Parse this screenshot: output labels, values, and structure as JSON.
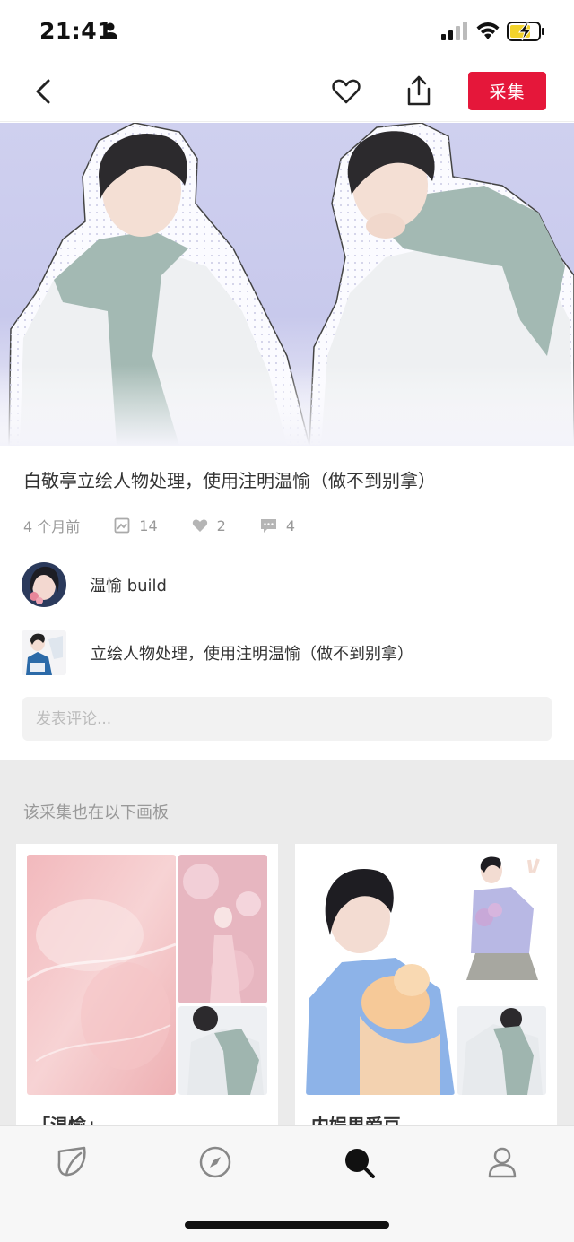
{
  "status_bar": {
    "time": "21:41",
    "icons": [
      "person-icon",
      "signal-icon",
      "wifi-icon",
      "battery-charging-icon"
    ]
  },
  "nav": {
    "back_icon": "chevron-left-icon",
    "like_icon": "heart-icon",
    "share_icon": "share-icon",
    "collect_label": "采集",
    "accent_color": "#e5173a"
  },
  "pin": {
    "title": "白敬亭立绘人物处理，使用注明温愉（做不到别拿）",
    "time_ago": "4 个月前",
    "repins": "14",
    "likes": "2",
    "comments": "4"
  },
  "author": {
    "name": "温愉 build"
  },
  "board": {
    "name": "立绘人物处理，使用注明温愉（做不到别拿）"
  },
  "comment": {
    "placeholder": "发表评论..."
  },
  "related": {
    "title": "该采集也在以下画板",
    "boards": [
      {
        "name": "「温愉」"
      },
      {
        "name": "内娱男爱豆"
      }
    ]
  },
  "tab_bar": {
    "tabs": [
      "home-leaf-icon",
      "compass-icon",
      "search-icon",
      "profile-icon"
    ],
    "active": "search-icon"
  }
}
